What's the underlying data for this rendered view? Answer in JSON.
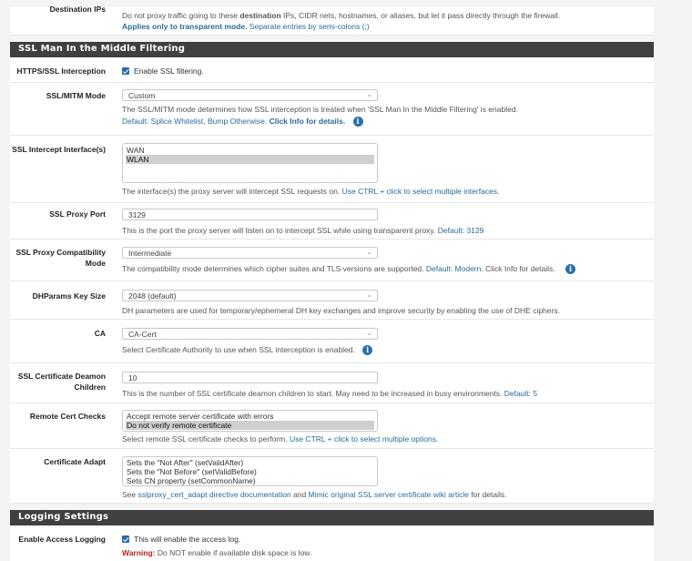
{
  "top_partial": {
    "label": "Destination IPs",
    "help_line1_pre": "Do not proxy traffic going to these ",
    "help_line1_bold": "destination",
    "help_line1_post": " IPs, CIDR nets, hostnames, or aliases, but let it pass directly through the firewall.",
    "help_line2_bold": "Applies only to transparent mode.",
    "help_line2_post": " Separate entries by semi-colons (;)"
  },
  "ssl_section": {
    "title": "SSL Man In the Middle Filtering",
    "https_interception": {
      "label": "HTTPS/SSL Interception",
      "checked": true,
      "checkbox_label": "Enable SSL filtering."
    },
    "mitm_mode": {
      "label": "SSL/MITM Mode",
      "value": "Custom",
      "help": "The SSL/MITM mode determines how SSL interception is treated when 'SSL Man In the Middle Filtering' is enabled.",
      "help_default": "Default: Splice Whitelist, Bump Otherwise.",
      "help_info": "Click Info for details."
    },
    "intercept_interfaces": {
      "label": "SSL Intercept Interface(s)",
      "options": [
        {
          "label": "WAN",
          "selected": false
        },
        {
          "label": "WLAN",
          "selected": true
        }
      ],
      "help": "The interface(s) the proxy server will intercept SSL requests on.",
      "help_link": "Use CTRL + click to select multiple interfaces."
    },
    "proxy_port": {
      "label": "SSL Proxy Port",
      "value": "3129",
      "help": "This is the port the proxy server will listen on to intercept SSL while using transparent proxy.",
      "help_default": "Default: 3129"
    },
    "compat_mode": {
      "label": "SSL Proxy Compatibility Mode",
      "value": "Intermediate",
      "help": "The compatibility mode determines which cipher suites and TLS versions are supported.",
      "help_default": "Default: Modern.",
      "help_info": "Click Info for details."
    },
    "dhparams": {
      "label": "DHParams Key Size",
      "value": "2048 (default)",
      "help": "DH parameters are used for temporary/ephemeral DH key exchanges and improve security by enabling the use of DHE ciphers."
    },
    "ca": {
      "label": "CA",
      "value": "CA-Cert",
      "help": "Select Certificate Authority to use when SSL interception is enabled."
    },
    "deamon_children": {
      "label": "SSL Certificate Deamon Children",
      "value": "10",
      "help": "This is the number of SSL certificate deamon children to start. May need to be increased in busy environments.",
      "help_default": "Default: 5"
    },
    "remote_cert_checks": {
      "label": "Remote Cert Checks",
      "options": [
        {
          "label": "Accept remote server certificate with errors",
          "selected": false
        },
        {
          "label": "Do not verify remote certificate",
          "selected": true
        }
      ],
      "help": "Select remote SSL certificate checks to perform.",
      "help_link": "Use CTRL + click to select multiple options."
    },
    "cert_adapt": {
      "label": "Certificate Adapt",
      "options": [
        {
          "label": "Sets the \"Not After\" (setValidAfter)",
          "selected": false
        },
        {
          "label": "Sets the \"Not Before\" (setValidBefore)",
          "selected": false
        },
        {
          "label": "Sets CN property (setCommonName)",
          "selected": false
        }
      ],
      "help_pre": "See ",
      "help_link1": "sslproxy_cert_adapt directive documentation",
      "help_mid": " and ",
      "help_link2": "Mimic original SSL server certificate wiki article",
      "help_post": " for details."
    }
  },
  "logging_section": {
    "title": "Logging Settings",
    "access_logging": {
      "label": "Enable Access Logging",
      "checked": true,
      "checkbox_label": "This will enable the access log.",
      "warning_label": "Warning:",
      "warning_text": " Do NOT enable if available disk space is low."
    }
  },
  "icons": {
    "info": "i",
    "chevron": "⌄"
  },
  "colors": {
    "section_header_bg": "#404040",
    "link": "#2a6b9a",
    "checkbox": "#2b6ca8",
    "info_icon": "#2a6fb0",
    "warning": "#b22222"
  }
}
